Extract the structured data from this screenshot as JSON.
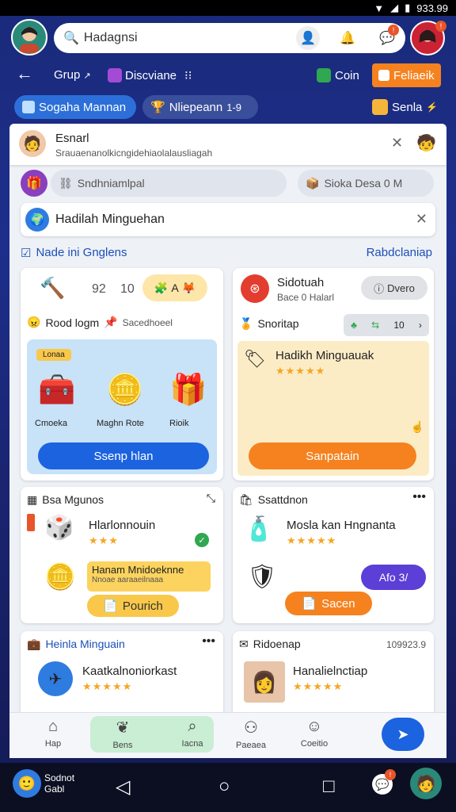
{
  "status": {
    "time": "933.99",
    "signal": "▼",
    "wifi": "◢",
    "battery": "▮"
  },
  "header": {
    "search_placeholder": "Hadagnsi",
    "profile_badge": "!",
    "bell_badge": "!",
    "right_badge": "!"
  },
  "nav": {
    "back": "←",
    "group_label": "Grup",
    "group_arrow": "↗",
    "discover_label": "Discviane",
    "coin_label": "Coin",
    "rewards_label": "Feliaeik"
  },
  "tabs": {
    "tab1": "Sogaha Mannan",
    "tab2": "Nliepeann",
    "tab2_count": "1-9",
    "sort": "Senla",
    "sort_arrow": "⚡"
  },
  "notice": {
    "name": "Esnarl",
    "subtitle": "Srauaenanolkicngidehiaolalausliagah"
  },
  "inputs": {
    "left": "Sndhniamlpal",
    "right": "Sioka Desa 0 M"
  },
  "banner": {
    "title": "Hadilah Minguehan"
  },
  "section": {
    "title": "Nade ini Gnglens",
    "link": "Rabdclaniap"
  },
  "card1": {
    "num1": "92",
    "num2": "10",
    "chip": "A",
    "heading": "Rood logm",
    "heading2": "Sacedhoeel",
    "tag": "Lonaa",
    "items": [
      "Cmoeka",
      "Maghn Rote",
      "Rioik"
    ],
    "button": "Ssenp hlan"
  },
  "card2": {
    "title": "Sidotuah",
    "subtitle": "Bace 0 Halarl",
    "button": "Dvero",
    "section": "Snoritap",
    "count": "10",
    "promo_title": "Hadikh Minguauak",
    "stars": "★★★★★",
    "action": "Sanpatain"
  },
  "card3": {
    "title": "Bsa Mgunos",
    "item1": "Hlarlonnouin",
    "item1_stars": "★★★",
    "item2_title": "Hanam Mnidoeknne",
    "item2_sub": "Nnoae aaraaeilnaaa",
    "button": "Pourich"
  },
  "card4": {
    "title": "Ssattdnon",
    "item": "Mosla kan Hngnanta",
    "item_stars": "★★★★★",
    "price": "Afo 3/",
    "button": "Sacen"
  },
  "card5": {
    "title": "Heinla Minguain",
    "item": "Kaatkalnoniorkast",
    "stars": "★★★★★"
  },
  "card6": {
    "title": "Ridoenap",
    "meta": "109923.9",
    "item": "Hanalielnctiap",
    "stars": "★★★★★"
  },
  "bottom_nav": {
    "items": [
      "Hap",
      "Bens",
      "Iacna",
      "Paeaea",
      "Coeitio"
    ]
  },
  "system": {
    "user_line1": "Sodnot",
    "user_line2": "Gabl",
    "notif_badge": "!"
  },
  "colors": {
    "accent": "#1c63e0",
    "orange": "#f5821f",
    "green": "#2fa84f",
    "purple": "#5b3fd6"
  }
}
